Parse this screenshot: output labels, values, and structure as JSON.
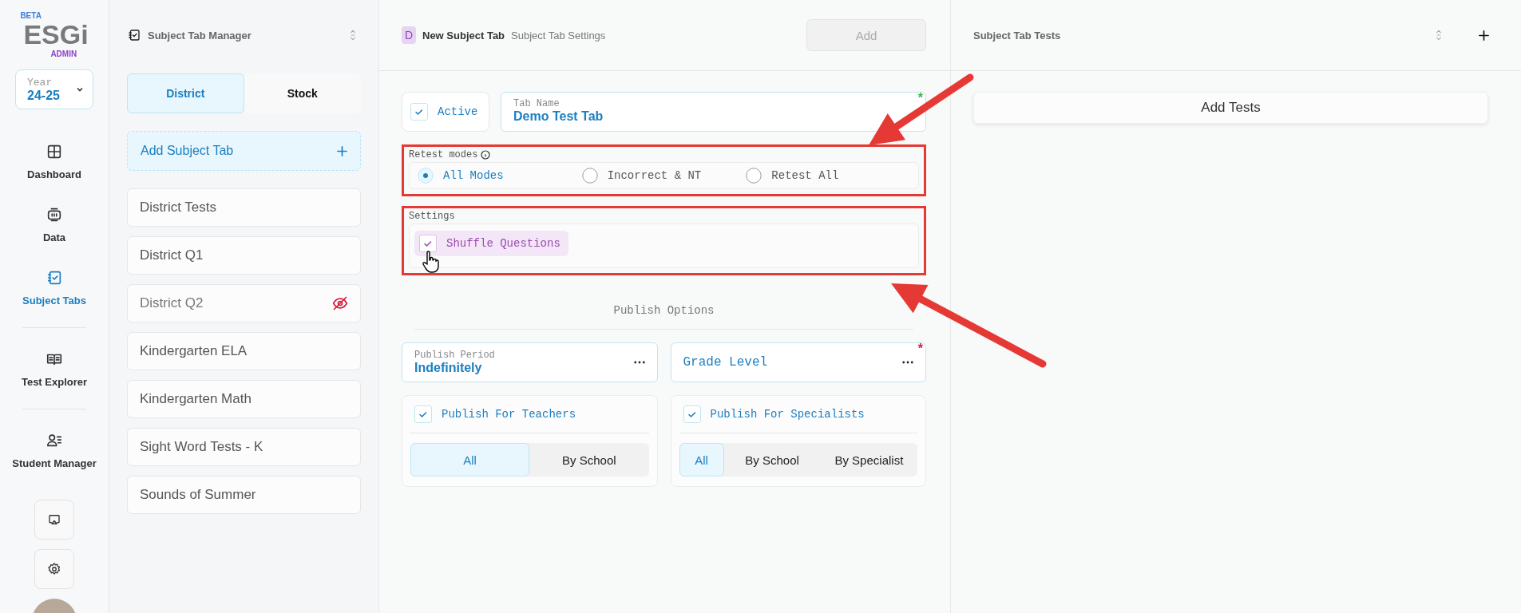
{
  "nav": {
    "logo": {
      "badge": "BETA",
      "name": "ESGi",
      "role": "ADMIN"
    },
    "year": {
      "label": "Year",
      "value": "24-25"
    },
    "items": [
      {
        "label": "Dashboard",
        "kind": "grid",
        "selected": false,
        "divider_before": false
      },
      {
        "label": "Data",
        "kind": "data",
        "selected": false,
        "divider_before": false
      },
      {
        "label": "Subject Tabs",
        "kind": "tabs",
        "selected": true,
        "divider_before": false
      },
      {
        "label": "Test Explorer",
        "kind": "book",
        "selected": false,
        "divider_before": true
      },
      {
        "label": "Student Manager",
        "kind": "students",
        "selected": false,
        "divider_before": true
      }
    ],
    "bottom": [
      {
        "kind": "screen"
      },
      {
        "kind": "settings"
      }
    ]
  },
  "manager": {
    "title": "Subject Tab Manager",
    "tabs": [
      {
        "label": "District",
        "selected": true
      },
      {
        "label": "Stock",
        "selected": false
      }
    ],
    "add_button": "Add Subject Tab",
    "items": [
      {
        "label": "District Tests",
        "hidden": false
      },
      {
        "label": "District Q1",
        "hidden": false
      },
      {
        "label": "District Q2",
        "hidden": true
      },
      {
        "label": "Kindergarten ELA",
        "hidden": false
      },
      {
        "label": "Kindergarten Math",
        "hidden": false
      },
      {
        "label": "Sight Word Tests - K",
        "hidden": false
      },
      {
        "label": "Sounds of Summer",
        "hidden": false
      }
    ]
  },
  "editor": {
    "badge": "D",
    "title": "New Subject Tab",
    "subtitle": "Subject Tab Settings",
    "add_button": {
      "label": "Add",
      "disabled": true
    },
    "active": {
      "label": "Active",
      "checked": true
    },
    "tab_name": {
      "label": "Tab Name",
      "value": "Demo Test Tab",
      "required_mark": "*"
    },
    "retest": {
      "label": "Retest modes",
      "highlighted": true,
      "options": [
        {
          "label": "All Modes",
          "selected": true
        },
        {
          "label": "Incorrect & NT",
          "selected": false
        },
        {
          "label": "Retest All",
          "selected": false
        }
      ]
    },
    "settings": {
      "label": "Settings",
      "highlighted": true,
      "options": [
        {
          "label": "Shuffle Questions",
          "checked": true
        }
      ]
    },
    "publish": {
      "heading": "Publish Options",
      "period": {
        "label": "Publish Period",
        "value": "Indefinitely"
      },
      "grade": {
        "label": "Grade Level",
        "required_mark": "*"
      },
      "groups": [
        {
          "label": "Publish For Teachers",
          "checked": true,
          "options": [
            {
              "label": "All",
              "selected": true
            },
            {
              "label": "By School",
              "selected": false
            }
          ]
        },
        {
          "label": "Publish For Specialists",
          "checked": true,
          "options": [
            {
              "label": "All",
              "selected": true
            },
            {
              "label": "By School",
              "selected": false
            },
            {
              "label": "By Specialist",
              "selected": false
            }
          ]
        }
      ]
    }
  },
  "tests": {
    "title": "Subject Tab Tests",
    "add_button": "Add Tests"
  }
}
